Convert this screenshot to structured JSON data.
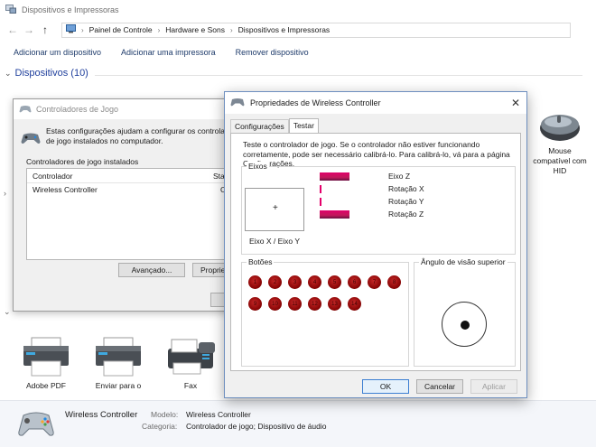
{
  "window": {
    "title": "Dispositivos e Impressoras"
  },
  "nav": {
    "back_glyph": "←",
    "forward_glyph": "→",
    "up_glyph": "↑"
  },
  "address": {
    "root": "Painel de Controle",
    "level2": "Hardware e Sons",
    "level3": "Dispositivos e Impressoras"
  },
  "toolbar": {
    "add_device": "Adicionar um dispositivo",
    "add_printer": "Adicionar uma impressora",
    "remove_device": "Remover dispositivo"
  },
  "devices_section": {
    "label": "Dispositivos (10)"
  },
  "mouse_device": {
    "label_line1": "Mouse",
    "label_line2": "compatível com",
    "label_line3": "HID"
  },
  "printers": [
    {
      "label_line1": "Adobe PDF",
      "label_line2": ""
    },
    {
      "label_line1": "Enviar para o",
      "label_line2": ""
    },
    {
      "label_line1": "Fax",
      "label_line2": ""
    }
  ],
  "details": {
    "name": "Wireless Controller",
    "model_key": "Modelo:",
    "model_value": "Wireless Controller",
    "category_key": "Categoria:",
    "category_value": "Controlador de jogo; Dispositivo de áudio"
  },
  "game_controllers": {
    "title": "Controladores de Jogo",
    "description": "Estas configurações ajudam a configurar os controladores de jogo instalados no computador.",
    "list_label": "Controladores de jogo instalados",
    "col_controller": "Controlador",
    "col_status": "Sta",
    "rows": [
      {
        "name": "Wireless Controller",
        "status": "O"
      }
    ],
    "advanced_button": "Avançado...",
    "properties_button": "Propried"
  },
  "properties": {
    "title": "Propriedades de Wireless Controller",
    "close_glyph": "✕",
    "tabs": [
      "Configurações",
      "Testar"
    ],
    "active_tab": 1,
    "description": "Teste o controlador de jogo. Se o controlador não estiver funcionando corretamente, pode ser necessário calibrá-lo. Para calibrá-lo, vá para a página Configurações.",
    "axes_group": "Eixos",
    "xy_label": "Eixo X / Eixo Y",
    "crosshair": "+",
    "axes": [
      {
        "name": "Eixo Z",
        "level": 0.55
      },
      {
        "name": "Rotação X",
        "level": 0.03
      },
      {
        "name": "Rotação Y",
        "level": 0.03
      },
      {
        "name": "Rotação Z",
        "level": 0.55
      }
    ],
    "buttons_group": "Botões",
    "buttons": [
      "1",
      "2",
      "3",
      "4",
      "5",
      "6",
      "7",
      "8",
      "9",
      "10",
      "11",
      "12",
      "13",
      "14"
    ],
    "pov_group": "Ângulo de visão superior",
    "ok": "OK",
    "cancel": "Cancelar",
    "apply": "Aplicar"
  }
}
